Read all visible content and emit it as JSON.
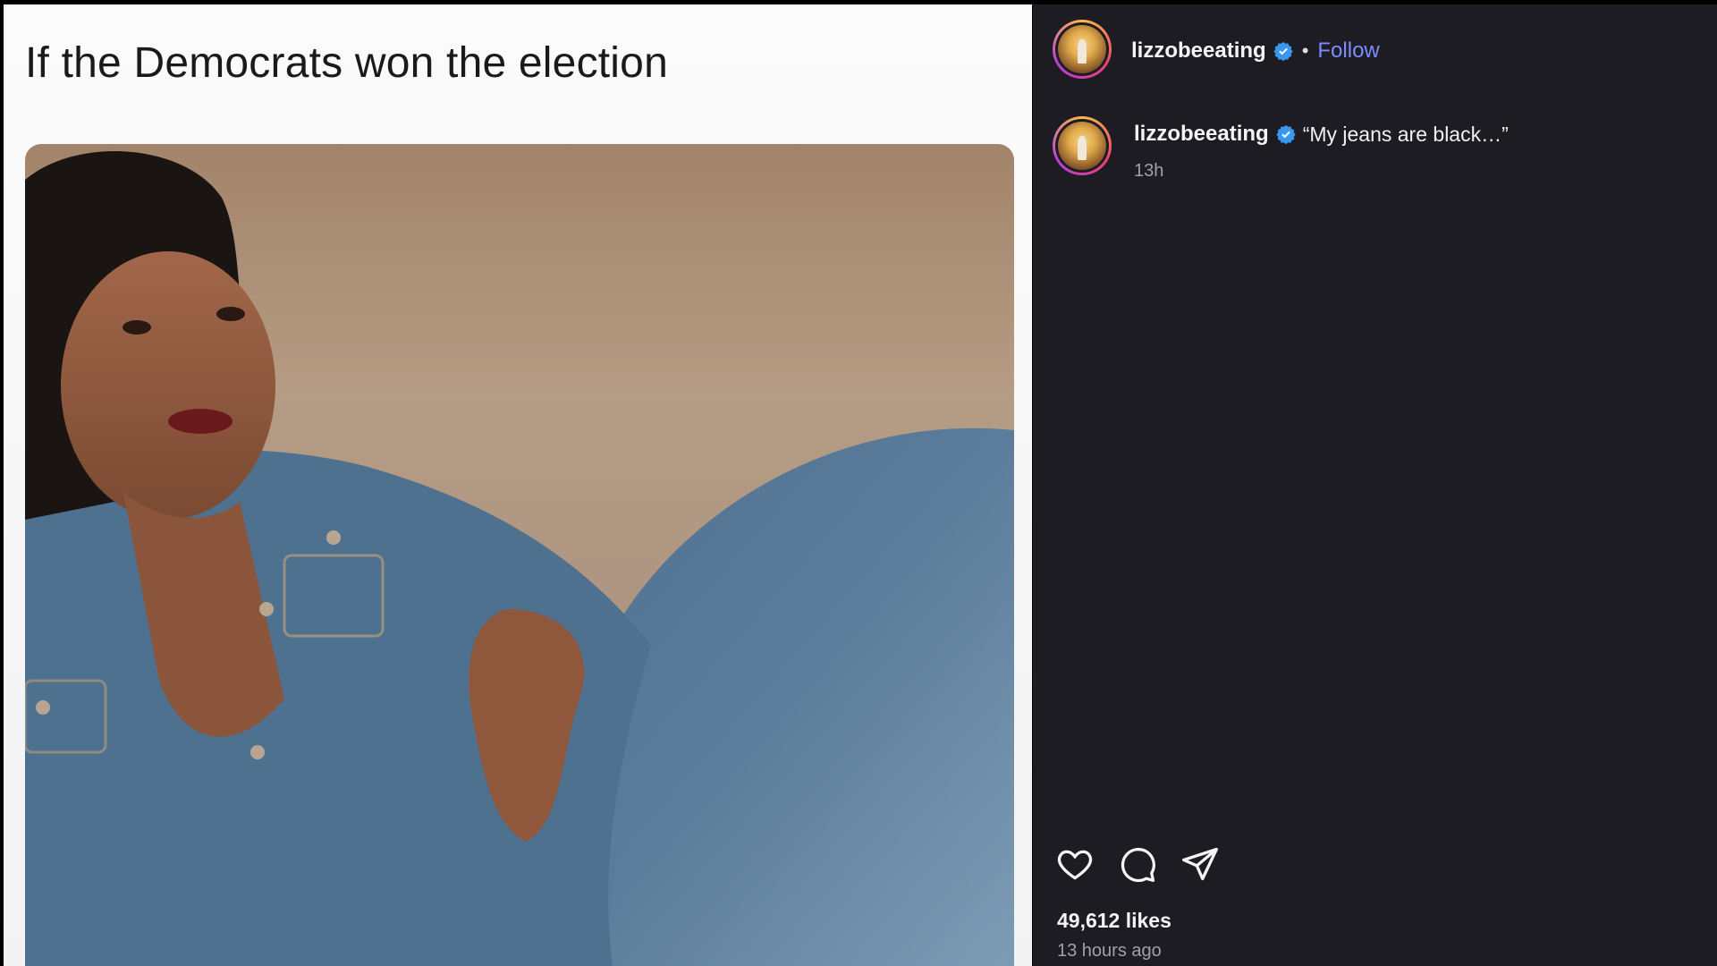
{
  "post": {
    "meme_caption": "If the Democrats won the election"
  },
  "header": {
    "username": "lizzobeeating",
    "follow_label": "Follow",
    "separator": "•"
  },
  "caption": {
    "username": "lizzobeeating",
    "text": "“My jeans are black…”",
    "time": "13h"
  },
  "engagement": {
    "likes": "49,612 likes",
    "posted_ago": "13 hours ago"
  },
  "icons": {
    "like": "heart-icon",
    "comment": "comment-icon",
    "share": "send-icon",
    "verified": "verified-badge-icon"
  },
  "colors": {
    "panel_bg": "#1c1c22",
    "follow": "#7c8cff",
    "verified": "#3897f0"
  }
}
